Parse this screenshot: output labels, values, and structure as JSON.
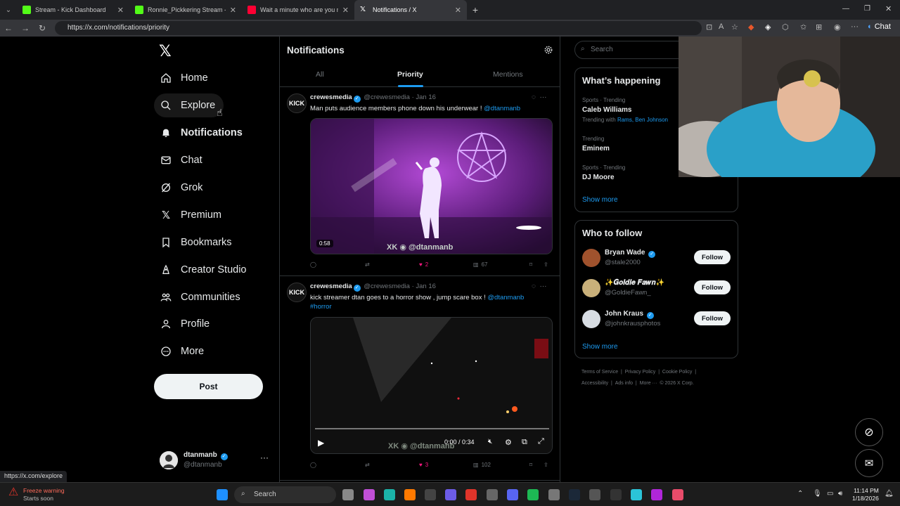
{
  "browser": {
    "tabs": [
      {
        "title": "Stream - Kick Dashboard",
        "favicon_color": "#53fc18"
      },
      {
        "title": "Ronnie_Pickkering Stream - Watc",
        "favicon_color": "#53fc18"
      },
      {
        "title": "Wait a minute who are you meme",
        "favicon_color": "#ff0033"
      },
      {
        "title": "Notifications / X",
        "favicon_color": "#ffffff"
      }
    ],
    "url": "https://x.com/notifications/priority",
    "chat_label": "Chat",
    "status_url": "https://x.com/explore"
  },
  "sidebar": {
    "items": [
      {
        "label": "Home",
        "icon": "home-icon"
      },
      {
        "label": "Explore",
        "icon": "search-icon"
      },
      {
        "label": "Notifications",
        "icon": "bell-icon"
      },
      {
        "label": "Chat",
        "icon": "mail-icon"
      },
      {
        "label": "Grok",
        "icon": "grok-icon"
      },
      {
        "label": "Premium",
        "icon": "x-logo-icon"
      },
      {
        "label": "Bookmarks",
        "icon": "bookmark-icon"
      },
      {
        "label": "Creator Studio",
        "icon": "creator-icon"
      },
      {
        "label": "Communities",
        "icon": "communities-icon"
      },
      {
        "label": "Profile",
        "icon": "person-icon"
      },
      {
        "label": "More",
        "icon": "more-circle-icon"
      }
    ],
    "post_label": "Post",
    "account": {
      "name": "dtanmanb",
      "handle": "@dtanmanb"
    }
  },
  "notifications": {
    "title": "Notifications",
    "tabs": [
      "All",
      "Priority",
      "Mentions"
    ],
    "active_tab": "Priority",
    "tweets": [
      {
        "name": "crewesmedia",
        "handle": "@crewesmedia",
        "date": "Jan 16",
        "text": "Man puts audience members phone down his underwear ! ",
        "mention": "@dtanmanb",
        "hashtag": "",
        "duration": "0:58",
        "watermark": "@dtanmanb",
        "likes": "2",
        "views": "67"
      },
      {
        "name": "crewesmedia",
        "handle": "@crewesmedia",
        "date": "Jan 16",
        "text": "kick streamer dtan goes to a horror show , jump scare box ! ",
        "mention": "@dtanmanb",
        "hashtag": "#horror",
        "time_display": "0:00 / 0:34",
        "watermark": "@dtanmanb",
        "likes": "3",
        "views": "102"
      }
    ],
    "avatar_text": "KICK"
  },
  "right": {
    "search_placeholder": "Search",
    "happening_title": "What’s happening",
    "trends": [
      {
        "category": "Sports · Trending",
        "name": "Caleb Williams",
        "with_prefix": "Trending with ",
        "with": "Rams, Ben Johnson"
      },
      {
        "category": "Trending",
        "name": "Eminem",
        "with_prefix": "",
        "with": ""
      },
      {
        "category": "Sports · Trending",
        "name": "DJ Moore",
        "with_prefix": "",
        "with": ""
      }
    ],
    "show_more": "Show more",
    "follow_title": "Who to follow",
    "follow": [
      {
        "name": "Bryan Wade",
        "handle": "@stale2000",
        "button": "Follow"
      },
      {
        "name": "✨𝑮𝒐𝒍𝒅𝒊𝒆 𝑭𝒂𝒘𝒏✨",
        "handle": "@GoldieFawn_",
        "button": "Follow"
      },
      {
        "name": "John Kraus",
        "handle": "@johnkrausphotos",
        "button": "Follow"
      }
    ],
    "footer": [
      "Terms of Service",
      "|",
      "Privacy Policy",
      "|",
      "Cookie Policy",
      "|",
      "Accessibility",
      "|",
      "Ads info",
      "|",
      "More ···",
      "© 2026 X Corp."
    ]
  },
  "taskbar": {
    "weather_title": "Freeze warning",
    "weather_sub": "Starts soon",
    "search": "Search",
    "time": "11:14 PM",
    "date": "1/18/2026"
  },
  "colors": {
    "accent": "#1d9bf0",
    "like": "#f91880",
    "bg": "#000000"
  }
}
